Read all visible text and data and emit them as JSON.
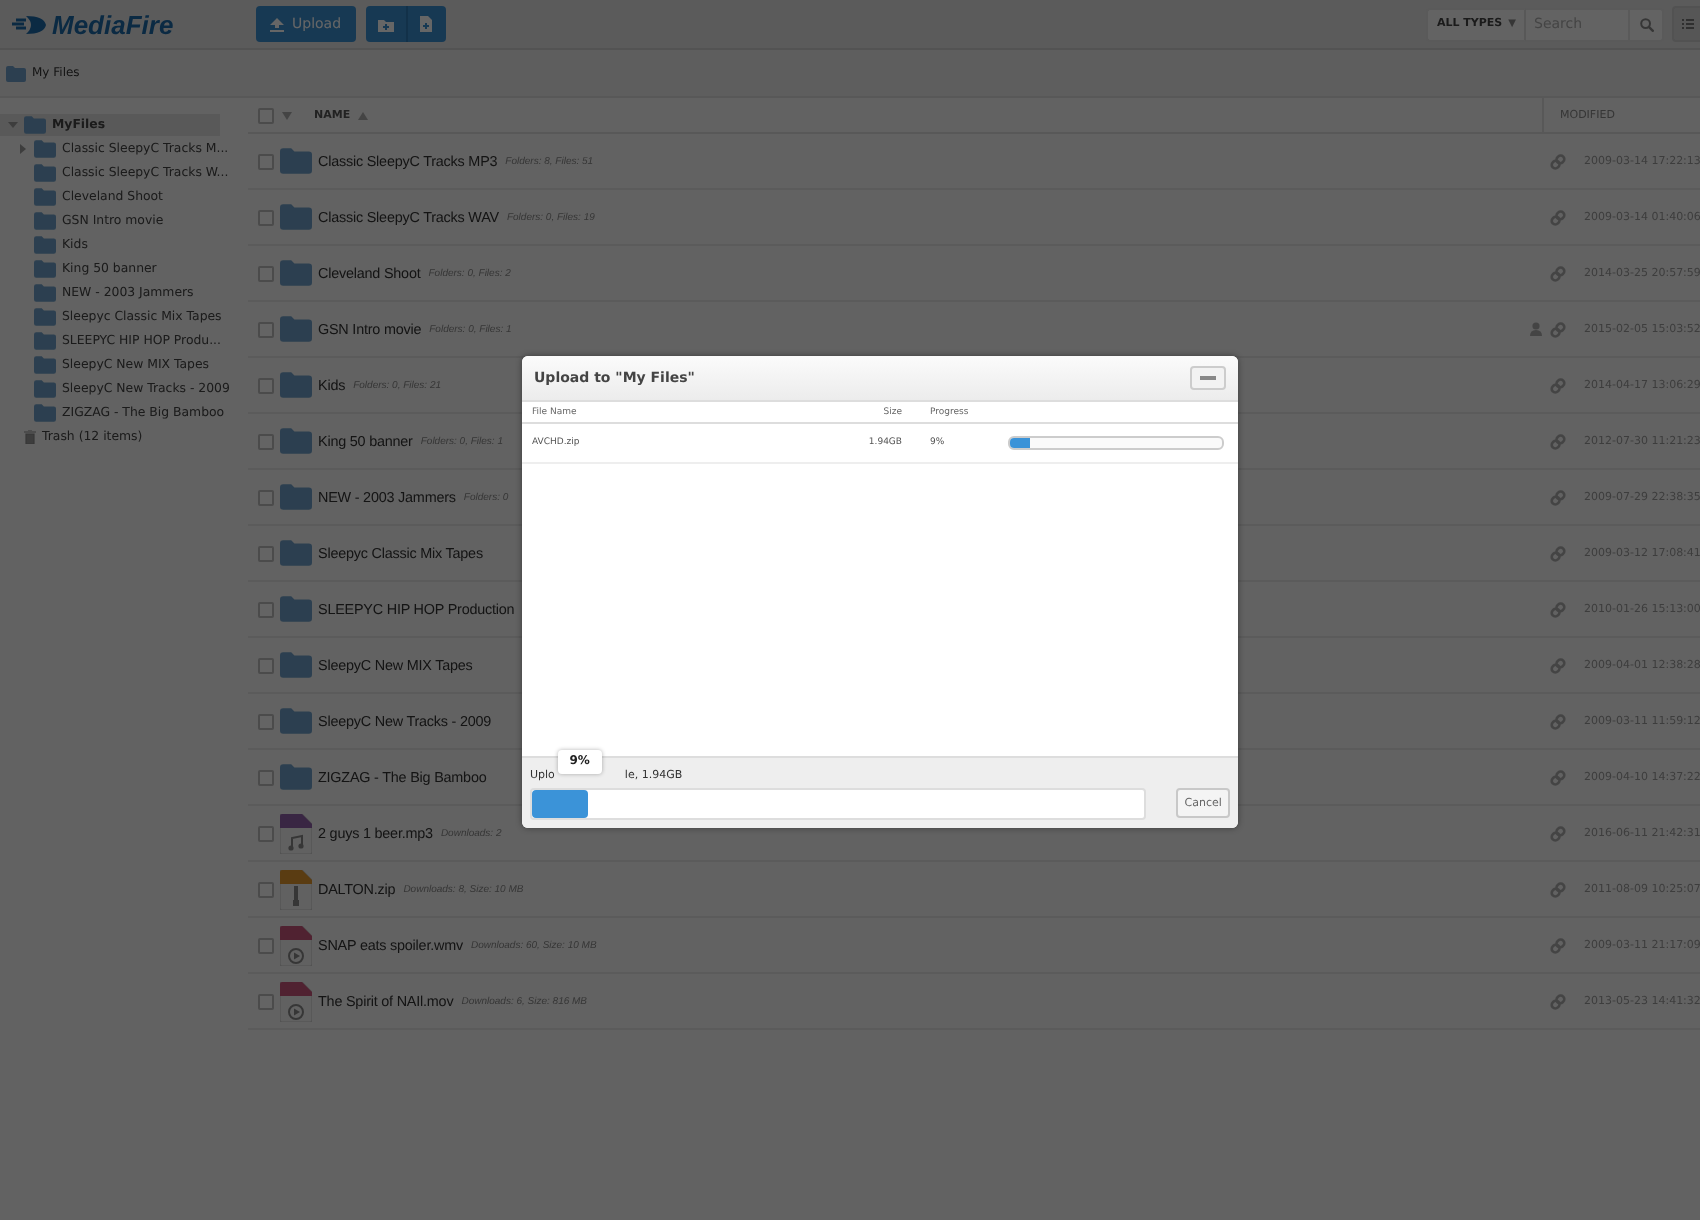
{
  "header": {
    "logo": "MediaFire",
    "upload_button": "Upload",
    "type_filter": "ALL TYPES",
    "filter_caret": "▼",
    "search": {
      "placeholder": "Search"
    }
  },
  "breadcrumb": {
    "label": "My Files"
  },
  "sidebar": {
    "root": {
      "label": "MyFiles",
      "expanded": true,
      "children": [
        {
          "label": "Classic SleepyC Tracks M...",
          "has_children": true
        },
        {
          "label": "Classic SleepyC Tracks W...",
          "has_children": false
        },
        {
          "label": "Cleveland Shoot",
          "has_children": false
        },
        {
          "label": "GSN Intro movie",
          "has_children": false
        },
        {
          "label": "Kids",
          "has_children": false
        },
        {
          "label": "King 50 banner",
          "has_children": false
        },
        {
          "label": "NEW - 2003 Jammers",
          "has_children": false
        },
        {
          "label": "Sleepyc Classic Mix Tapes",
          "has_children": false
        },
        {
          "label": "SLEEPYC HIP HOP Produ...",
          "has_children": false
        },
        {
          "label": "SleepyC New MIX Tapes",
          "has_children": false
        },
        {
          "label": "SleepyC New Tracks - 2009",
          "has_children": false
        },
        {
          "label": "ZIGZAG - The Big Bamboo",
          "has_children": false
        }
      ]
    },
    "trash": "Trash (12 items)"
  },
  "table": {
    "select_all_checked": false,
    "columns": {
      "name": "NAME",
      "modified": "MODIFIED"
    },
    "rows": [
      {
        "kind": "folder",
        "name": "Classic SleepyC Tracks MP3",
        "meta": "Folders: 8, Files: 51",
        "modified": "2009-03-14 17:22:13",
        "checked": false,
        "shared": false
      },
      {
        "kind": "folder",
        "name": "Classic SleepyC Tracks WAV",
        "meta": "Folders: 0, Files: 19",
        "modified": "2009-03-14 01:40:06",
        "checked": false,
        "shared": false
      },
      {
        "kind": "folder",
        "name": "Cleveland Shoot",
        "meta": "Folders: 0, Files: 2",
        "modified": "2014-03-25 20:57:59",
        "checked": false,
        "shared": false
      },
      {
        "kind": "folder",
        "name": "GSN Intro movie",
        "meta": "Folders: 0, Files: 1",
        "modified": "2015-02-05 15:03:52",
        "checked": false,
        "shared": true
      },
      {
        "kind": "folder",
        "name": "Kids",
        "meta": "Folders: 0, Files: 21",
        "modified": "2014-04-17 13:06:29",
        "checked": false,
        "shared": false
      },
      {
        "kind": "folder",
        "name": "King 50 banner",
        "meta": "Folders: 0, Files: 1",
        "modified": "2012-07-30 11:21:23",
        "checked": false,
        "shared": false
      },
      {
        "kind": "folder",
        "name": "NEW - 2003 Jammers",
        "meta": "Folders: 0",
        "modified": "2009-07-29 22:38:35",
        "checked": false,
        "shared": false
      },
      {
        "kind": "folder",
        "name": "Sleepyc Classic Mix Tapes",
        "modified": "2009-03-12 17:08:41",
        "checked": false,
        "shared": false
      },
      {
        "kind": "folder",
        "name": "SLEEPYC HIP HOP Production",
        "modified": "2010-01-26 15:13:00",
        "checked": false,
        "shared": false
      },
      {
        "kind": "folder",
        "name": "SleepyC New MIX Tapes",
        "modified": "2009-04-01 12:38:28",
        "checked": false,
        "shared": false
      },
      {
        "kind": "folder",
        "name": "SleepyC New Tracks - 2009",
        "modified": "2009-03-11 11:59:12",
        "checked": false,
        "shared": false
      },
      {
        "kind": "folder",
        "name": "ZIGZAG - The Big Bamboo",
        "modified": "2009-04-10 14:37:22",
        "checked": false,
        "shared": false
      },
      {
        "kind": "audio",
        "name": "2 guys 1 beer.mp3",
        "meta": "Downloads: 2",
        "modified": "2016-06-11 21:42:31",
        "checked": false,
        "shared": false
      },
      {
        "kind": "archive",
        "name": "DALTON.zip",
        "meta": "Downloads: 8, Size: 10 MB",
        "modified": "2011-08-09 10:25:07",
        "checked": false,
        "shared": false
      },
      {
        "kind": "video",
        "name": "SNAP eats spoiler.wmv",
        "meta": "Downloads: 60, Size: 10 MB",
        "modified": "2009-03-11 21:17:09",
        "checked": false,
        "shared": false
      },
      {
        "kind": "video",
        "name": "The Spirit of NAIl.mov",
        "meta": "Downloads: 6, Size: 816 MB",
        "modified": "2013-05-23 14:41:32",
        "checked": false,
        "shared": false
      }
    ]
  },
  "upload_dialog": {
    "title": "Upload to \"My Files\"",
    "columns": [
      "File Name",
      "Size",
      "Progress"
    ],
    "files": [
      {
        "name": "AVCHD.zip",
        "size": "1.94GB",
        "percent": "9%",
        "level": 0.09
      }
    ],
    "status_start": "Uplo",
    "status_end": "le, 1.94GB",
    "tooltip": "9%",
    "level": 0.09,
    "cancel": "Cancel"
  }
}
